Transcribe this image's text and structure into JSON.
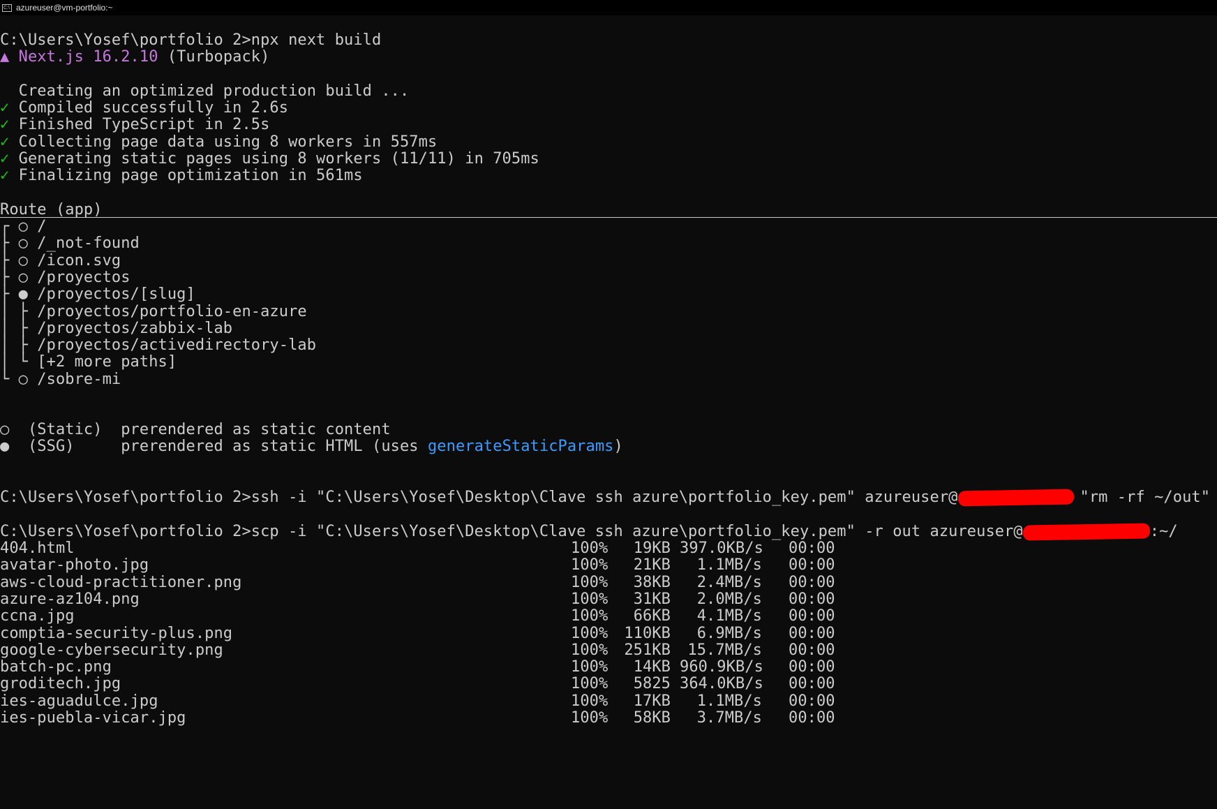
{
  "window": {
    "title": "azureuser@vm-portfolio:~",
    "icon": "cmd-window-icon",
    "icon_text": "C:\\"
  },
  "build": {
    "prompt_cmd": "C:\\Users\\Yosef\\portfolio 2>npx next build",
    "next_marker": "▲",
    "next_version": "Next.js 16.2.10",
    "bundler": " (Turbopack)",
    "creating": "  Creating an optimized production build ...",
    "check_glyph": "✓",
    "steps": [
      " Compiled successfully in 2.6s",
      " Finished TypeScript in 2.5s",
      " Collecting page data using 8 workers in 557ms",
      " Generating static pages using 8 workers (11/11) in 705ms",
      " Finalizing page optimization in 561ms"
    ]
  },
  "routes": {
    "header": "Route (app)",
    "items": [
      "┌ ○ /",
      "├ ○ /_not-found",
      "├ ○ /icon.svg",
      "├ ○ /proyectos",
      "├ ● /proyectos/[slug]",
      "│ ├ /proyectos/portfolio-en-azure",
      "│ ├ /proyectos/zabbix-lab",
      "│ ├ /proyectos/activedirectory-lab",
      "│ └ [+2 more paths]",
      "└ ○ /sobre-mi"
    ],
    "legend_static": "○  (Static)  prerendered as static content",
    "legend_ssg_prefix": "●  (SSG)     prerendered as static HTML (uses ",
    "legend_ssg_fn": "generateStaticParams",
    "legend_ssg_suffix": ")"
  },
  "ssh": {
    "cmd_before": "C:\\Users\\Yosef\\portfolio 2>ssh -i \"C:\\Users\\Yosef\\Desktop\\Clave ssh azure\\portfolio_key.pem\" azureuser@",
    "cmd_after": "\"rm -rf ~/out\""
  },
  "scp": {
    "cmd_before": "C:\\Users\\Yosef\\portfolio 2>scp -i \"C:\\Users\\Yosef\\Desktop\\Clave ssh azure\\portfolio_key.pem\" -r out azureuser@",
    "cmd_after": ":~/",
    "files": [
      {
        "name": "404.html",
        "pct": "100%",
        "size": "19KB",
        "rate": "397.0KB/s",
        "eta": "00:00"
      },
      {
        "name": "avatar-photo.jpg",
        "pct": "100%",
        "size": "21KB",
        "rate": "1.1MB/s",
        "eta": "00:00"
      },
      {
        "name": "aws-cloud-practitioner.png",
        "pct": "100%",
        "size": "38KB",
        "rate": "2.4MB/s",
        "eta": "00:00"
      },
      {
        "name": "azure-az104.png",
        "pct": "100%",
        "size": "31KB",
        "rate": "2.0MB/s",
        "eta": "00:00"
      },
      {
        "name": "ccna.jpg",
        "pct": "100%",
        "size": "66KB",
        "rate": "4.1MB/s",
        "eta": "00:00"
      },
      {
        "name": "comptia-security-plus.png",
        "pct": "100%",
        "size": "110KB",
        "rate": "6.9MB/s",
        "eta": "00:00"
      },
      {
        "name": "google-cybersecurity.png",
        "pct": "100%",
        "size": "251KB",
        "rate": "15.7MB/s",
        "eta": "00:00"
      },
      {
        "name": "batch-pc.png",
        "pct": "100%",
        "size": "14KB",
        "rate": "960.9KB/s",
        "eta": "00:00"
      },
      {
        "name": "groditech.jpg",
        "pct": "100%",
        "size": "5825",
        "rate": "364.0KB/s",
        "eta": "00:00"
      },
      {
        "name": "ies-aguadulce.jpg",
        "pct": "100%",
        "size": "17KB",
        "rate": "1.1MB/s",
        "eta": "00:00"
      },
      {
        "name": "ies-puebla-vicar.jpg",
        "pct": "100%",
        "size": "58KB",
        "rate": "3.7MB/s",
        "eta": "00:00"
      }
    ]
  },
  "colors": {
    "background": "#0c0c0c",
    "text": "#cccccc",
    "next_purple": "#c678dd",
    "success_green": "#16c60c",
    "link_blue": "#3b9cff",
    "redaction_red": "#ff0000"
  }
}
